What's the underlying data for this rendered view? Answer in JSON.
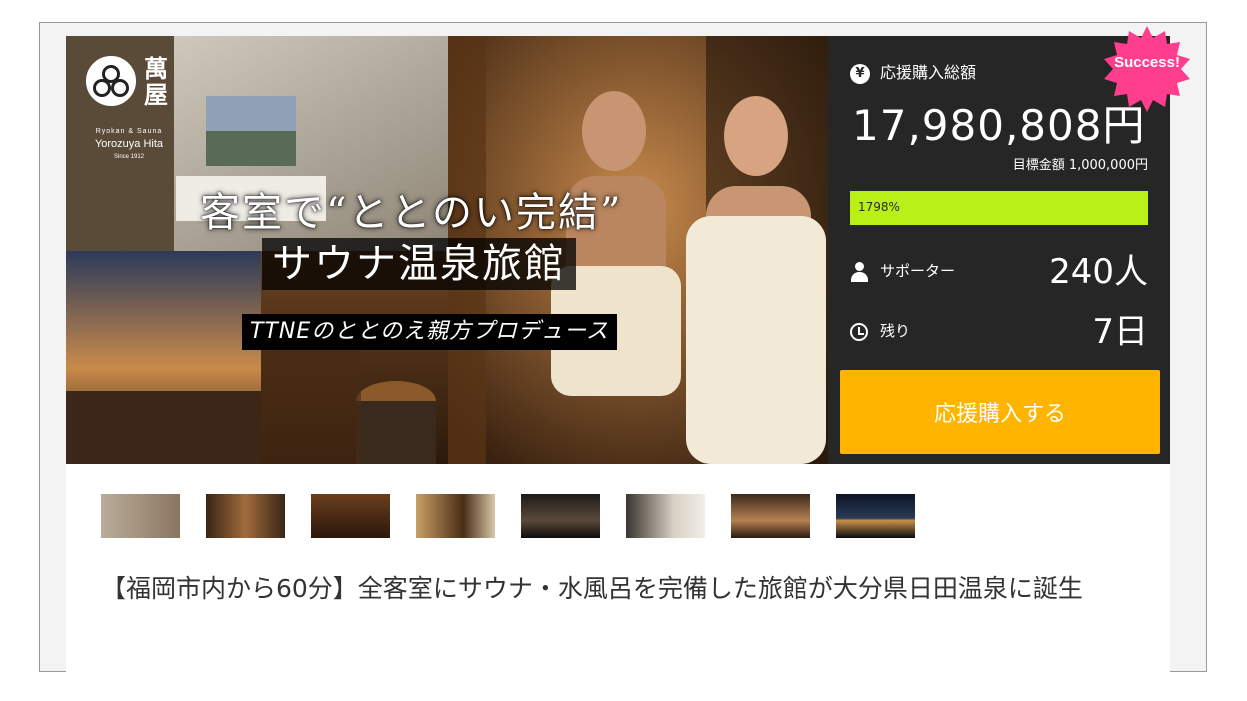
{
  "hero": {
    "logo_kanji": "萬屋",
    "logo_subtitle1": "Ryokan & Sauna",
    "logo_subtitle2": "Yorozuya Hita",
    "logo_subtitle3": "Since 1912",
    "headline1": "客室で“ととのい完結”",
    "headline2": "サウナ温泉旅館",
    "headline3": "TTNEのととのえ親方プロデュース"
  },
  "stats": {
    "badge": "Success!",
    "total_label": "応援購入総額",
    "total_amount": "17,980,808円",
    "goal_text": "目標金額 1,000,000円",
    "progress_text": "1798%",
    "progress_percent": 1798,
    "supporters_label": "サポーター",
    "supporters_value": "240人",
    "remaining_label": "残り",
    "remaining_value": "7日",
    "cta_label": "応援購入する",
    "yen_icon": "¥"
  },
  "thumbnails": [
    {
      "name": "thumb-1"
    },
    {
      "name": "thumb-2"
    },
    {
      "name": "thumb-3"
    },
    {
      "name": "thumb-4"
    },
    {
      "name": "thumb-5"
    },
    {
      "name": "thumb-6"
    },
    {
      "name": "thumb-7"
    },
    {
      "name": "thumb-8"
    }
  ],
  "project_title": "【福岡市内から60分】全客室にサウナ・水風呂を完備した旅館が大分県日田温泉に誕生",
  "colors": {
    "panel_bg": "#262626",
    "progress": "#b9f018",
    "cta": "#ffb400",
    "badge": "#ff3f8e"
  }
}
